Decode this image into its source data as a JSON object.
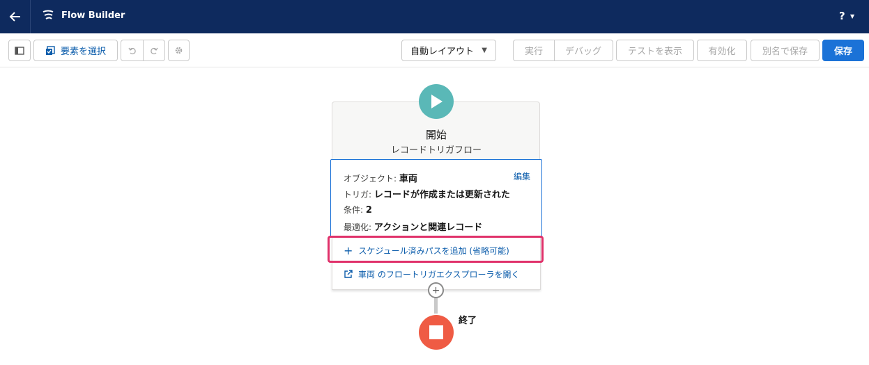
{
  "header": {
    "app_title": "Flow Builder",
    "help_label": "?"
  },
  "toolbar": {
    "select_elements_label": "要素を選択",
    "layout_select_value": "自動レイアウト",
    "run_label": "実行",
    "debug_label": "デバッグ",
    "view_tests_label": "テストを表示",
    "activate_label": "有効化",
    "save_as_label": "別名で保存",
    "save_label": "保存"
  },
  "start_node": {
    "title": "開始",
    "subtitle": "レコードトリガフロー",
    "edit_label": "編集",
    "details": [
      {
        "label": "オブジェクト:",
        "value": "車両"
      },
      {
        "label": "トリガ:",
        "value": "レコードが作成または更新された"
      },
      {
        "label": "条件:",
        "value": "2"
      },
      {
        "label": "最適化:",
        "value": "アクションと関連レコード"
      }
    ],
    "add_scheduled_path_label": "スケジュール済みパスを追加 (省略可能)",
    "open_explorer_label": "車両 のフロートリガエクスプローラを開く"
  },
  "end_node": {
    "label": "終了"
  },
  "colors": {
    "header_bg": "#0e2a5e",
    "primary": "#1b72d7",
    "start": "#5ab8b7",
    "end": "#ef5b44",
    "highlight": "#e0316a"
  }
}
